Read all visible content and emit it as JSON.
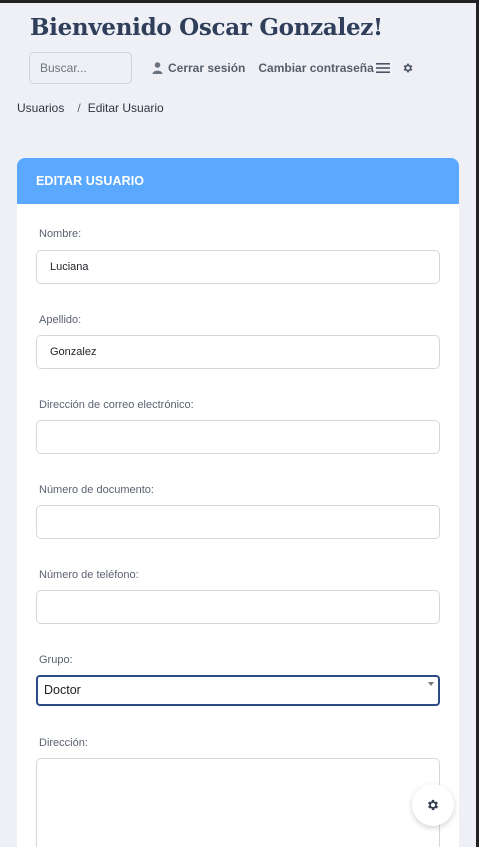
{
  "header": {
    "welcome": "Bienvenido Oscar Gonzalez!",
    "search_placeholder": "Buscar...",
    "logout_label": "Cerrar sesión",
    "change_password_label": "Cambiar contraseña",
    "icons": [
      "user-icon",
      "menu-icon",
      "gear-icon"
    ]
  },
  "breadcrumb": {
    "items": [
      "Usuarios",
      "Editar Usuario"
    ],
    "separator": "/"
  },
  "form": {
    "title": "EDITAR USUARIO",
    "accent_color": "#5aa9ff",
    "fields": {
      "nombre": {
        "label": "Nombre:",
        "value": "Luciana"
      },
      "apellido": {
        "label": "Apellido:",
        "value": "Gonzalez"
      },
      "email": {
        "label": "Dirección de correo electrónico:",
        "value": ""
      },
      "documento": {
        "label": "Número de documento:",
        "value": ""
      },
      "telefono": {
        "label": "Número de teléfono:",
        "value": ""
      },
      "grupo": {
        "label": "Grupo:",
        "value": "Doctor"
      },
      "direccion": {
        "label": "Dirección:",
        "value": ""
      }
    }
  },
  "fab": {
    "icon": "gear-icon"
  }
}
